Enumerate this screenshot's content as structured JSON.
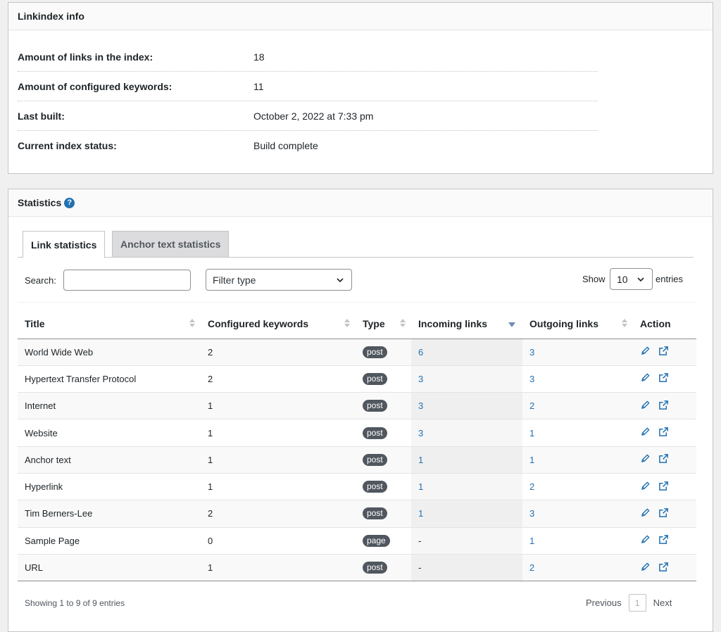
{
  "info_panel": {
    "title": "Linkindex info",
    "rows": [
      {
        "label": "Amount of links in the index:",
        "value": "18"
      },
      {
        "label": "Amount of configured keywords:",
        "value": "11"
      },
      {
        "label": "Last built:",
        "value": "October 2, 2022 at 7:33 pm"
      },
      {
        "label": "Current index status:",
        "value": "Build complete"
      }
    ]
  },
  "stats_panel": {
    "title": "Statistics",
    "help_icon": "?",
    "tabs": [
      {
        "label": "Link statistics",
        "active": true
      },
      {
        "label": "Anchor text statistics",
        "active": false
      }
    ],
    "search_label": "Search:",
    "search_value": "",
    "filter_placeholder": "Filter type",
    "show_label": "Show",
    "entries_value": "10",
    "entries_label": "entries",
    "columns": [
      "Title",
      "Configured keywords",
      "Type",
      "Incoming links",
      "Outgoing links",
      "Action"
    ],
    "rows": [
      [
        "World Wide Web",
        "2",
        "post",
        "6",
        "3"
      ],
      [
        "Hypertext Transfer Protocol",
        "2",
        "post",
        "3",
        "3"
      ],
      [
        "Internet",
        "1",
        "post",
        "3",
        "2"
      ],
      [
        "Website",
        "1",
        "post",
        "3",
        "1"
      ],
      [
        "Anchor text",
        "1",
        "post",
        "1",
        "1"
      ],
      [
        "Hyperlink",
        "1",
        "post",
        "1",
        "2"
      ],
      [
        "Tim Berners-Lee",
        "2",
        "post",
        "1",
        "3"
      ],
      [
        "Sample Page",
        "0",
        "page",
        "-",
        "1"
      ],
      [
        "URL",
        "1",
        "post",
        "-",
        "2"
      ]
    ],
    "footer_info": "Showing 1 to 9 of 9 entries",
    "pager": {
      "previous": "Previous",
      "page": "1",
      "next": "Next"
    }
  },
  "colors": {
    "accent": "#2271b1",
    "badge": "#50575e"
  }
}
